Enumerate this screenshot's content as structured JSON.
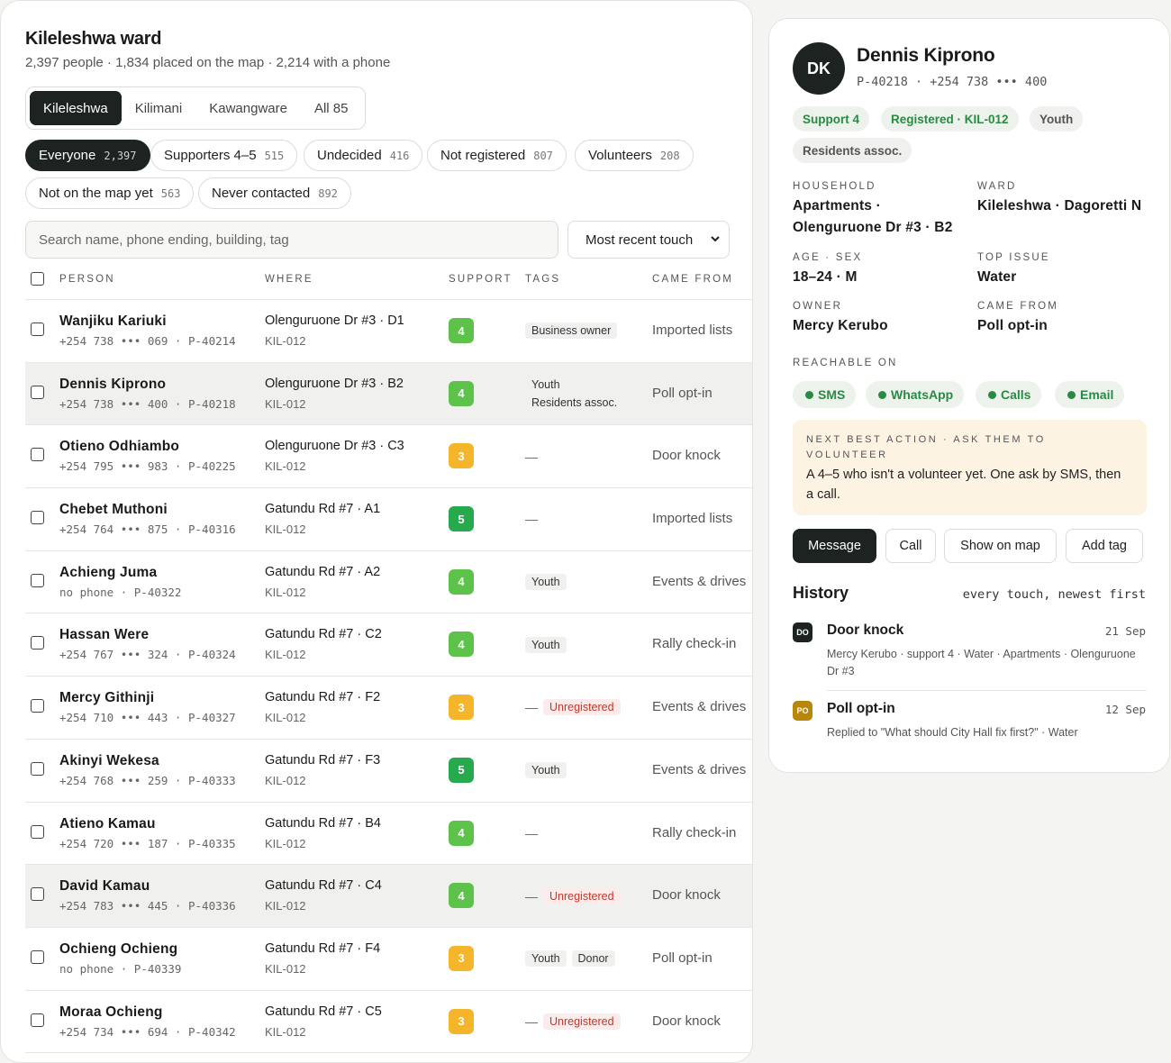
{
  "ward": {
    "title": "Kileleshwa ward",
    "subtitle": "2,397 people · 1,834 placed on the map · 2,214 with a phone"
  },
  "ward_tabs": [
    "Kileleshwa",
    "Kilimani",
    "Kawangware",
    "All 85"
  ],
  "filters": [
    {
      "label": "Everyone",
      "count": "2,397"
    },
    {
      "label": "Supporters 4–5",
      "count": "515"
    },
    {
      "label": "Undecided",
      "count": "416"
    },
    {
      "label": "Not registered",
      "count": "807"
    },
    {
      "label": "Volunteers",
      "count": "208"
    },
    {
      "label": "Not on the map yet",
      "count": "563"
    },
    {
      "label": "Never contacted",
      "count": "892"
    }
  ],
  "search": {
    "placeholder": "Search name, phone ending, building, tag"
  },
  "sort": {
    "selected": "Most recent touch"
  },
  "columns": {
    "person": "PERSON",
    "where": "WHERE",
    "support": "SUPPORT",
    "tags": "TAGS",
    "came_from": "CAME FROM"
  },
  "people": [
    {
      "name": "Wanjiku Kariuki",
      "meta": "+254 738 ••• 069 · P-40214",
      "where": "Olenguruone Dr #3 · D1",
      "code": "KIL-012",
      "support": "4",
      "tags": [
        "Business owner"
      ],
      "unregistered": "",
      "came_from": "Imported lists"
    },
    {
      "name": "Dennis Kiprono",
      "meta": "+254 738 ••• 400 · P-40218",
      "where": "Olenguruone Dr #3 · B2",
      "code": "KIL-012",
      "support": "4",
      "tags": [
        "Youth",
        "Residents assoc."
      ],
      "unregistered": "",
      "came_from": "Poll opt-in"
    },
    {
      "name": "Otieno Odhiambo",
      "meta": "+254 795 ••• 983 · P-40225",
      "where": "Olenguruone Dr #3 · C3",
      "code": "KIL-012",
      "support": "3",
      "tags": [],
      "unregistered": "",
      "came_from": "Door knock"
    },
    {
      "name": "Chebet Muthoni",
      "meta": "+254 764 ••• 875 · P-40316",
      "where": "Gatundu Rd #7 · A1",
      "code": "KIL-012",
      "support": "5",
      "tags": [],
      "unregistered": "",
      "came_from": "Imported lists"
    },
    {
      "name": "Achieng Juma",
      "meta": "no phone · P-40322",
      "where": "Gatundu Rd #7 · A2",
      "code": "KIL-012",
      "support": "4",
      "tags": [
        "Youth"
      ],
      "unregistered": "",
      "came_from": "Events & drives"
    },
    {
      "name": "Hassan Were",
      "meta": "+254 767 ••• 324 · P-40324",
      "where": "Gatundu Rd #7 · C2",
      "code": "KIL-012",
      "support": "4",
      "tags": [
        "Youth"
      ],
      "unregistered": "",
      "came_from": "Rally check-in"
    },
    {
      "name": "Mercy Githinji",
      "meta": "+254 710 ••• 443 · P-40327",
      "where": "Gatundu Rd #7 · F2",
      "code": "KIL-012",
      "support": "3",
      "tags": [],
      "unregistered": "Unregistered",
      "came_from": "Events & drives"
    },
    {
      "name": "Akinyi Wekesa",
      "meta": "+254 768 ••• 259 · P-40333",
      "where": "Gatundu Rd #7 · F3",
      "code": "KIL-012",
      "support": "5",
      "tags": [
        "Youth"
      ],
      "unregistered": "",
      "came_from": "Events & drives"
    },
    {
      "name": "Atieno Kamau",
      "meta": "+254 720 ••• 187 · P-40335",
      "where": "Gatundu Rd #7 · B4",
      "code": "KIL-012",
      "support": "4",
      "tags": [],
      "unregistered": "",
      "came_from": "Rally check-in"
    },
    {
      "name": "David Kamau",
      "meta": "+254 783 ••• 445 · P-40336",
      "where": "Gatundu Rd #7 · C4",
      "code": "KIL-012",
      "support": "4",
      "tags": [],
      "unregistered": "Unregistered",
      "came_from": "Door knock"
    },
    {
      "name": "Ochieng Ochieng",
      "meta": "no phone · P-40339",
      "where": "Gatundu Rd #7 · F4",
      "code": "KIL-012",
      "support": "3",
      "tags": [
        "Youth",
        "Donor"
      ],
      "unregistered": "",
      "came_from": "Poll opt-in"
    },
    {
      "name": "Moraa Ochieng",
      "meta": "+254 734 ••• 694 · P-40342",
      "where": "Gatundu Rd #7 · C5",
      "code": "KIL-012",
      "support": "3",
      "tags": [],
      "unregistered": "Unregistered",
      "came_from": "Door knock"
    }
  ],
  "empty_tag": "—",
  "support_colors": {
    "3": "#f4b52a",
    "4": "#5cc24a",
    "5": "#27a94d"
  },
  "detail": {
    "initials": "DK",
    "name": "Dennis Kiprono",
    "meta": "P-40218 · +254 738 ••• 400",
    "pills": [
      "Support 4",
      "Registered · KIL-012",
      "Youth",
      "Residents assoc."
    ],
    "household_label": "HOUSEHOLD",
    "household": "Apartments · Olenguruone Dr #3 · B2",
    "ward_label": "WARD",
    "ward": "Kileleshwa · Dagoretti N",
    "age_label": "AGE · SEX",
    "age": "18–24 · M",
    "issue_label": "TOP ISSUE",
    "issue": "Water",
    "owner_label": "OWNER",
    "owner": "Mercy Kerubo",
    "came_label": "CAME FROM",
    "came": "Poll opt-in",
    "reach_label": "REACHABLE ON",
    "reach": [
      "SMS",
      "WhatsApp",
      "Calls",
      "Email"
    ],
    "nba_label": "NEXT BEST ACTION · ASK THEM TO VOLUNTEER",
    "nba_text": "A 4–5 who isn't a volunteer yet. One ask by SMS, then a call.",
    "buttons": [
      "Message",
      "Call",
      "Show on map",
      "Add tag"
    ],
    "history_title": "History",
    "history_sub": "every touch, newest first",
    "history": [
      {
        "badge": "DO",
        "title": "Door knock",
        "date": "21 Sep",
        "desc": "Mercy Kerubo · support 4 · Water · Apartments · Olenguruone Dr #3",
        "color": "#1d2320"
      },
      {
        "badge": "PO",
        "title": "Poll opt-in",
        "date": "12 Sep",
        "desc": "Replied to \"What should City Hall fix first?\" · Water",
        "color": "#b8860b"
      }
    ]
  }
}
